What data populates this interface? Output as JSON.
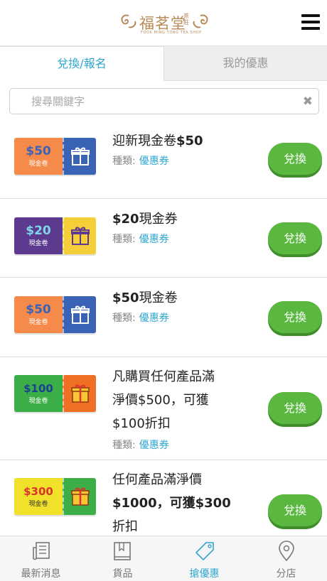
{
  "header": {
    "logo_text": "福茗堂",
    "logo_badge": "茶莊",
    "logo_subtitle": "FOOK MING TONG TEA SHOP"
  },
  "tabs": [
    {
      "label": "兌換/報名"
    },
    {
      "label": "我的優惠"
    }
  ],
  "search": {
    "placeholder": "搜尋關鍵字",
    "value": ""
  },
  "type_label": "種類:",
  "items": [
    {
      "coupon_amount": "$50",
      "coupon_tag": "現金卷",
      "coupon_color": "#f58a4a",
      "gift_color": "#3a63b5",
      "title_pre": "迎新現金卷",
      "title_bold": "$50",
      "title_post": "",
      "title2": "",
      "title3": "",
      "type_value": "優惠券",
      "button": "兌換"
    },
    {
      "coupon_amount": "$20",
      "coupon_tag": "現金卷",
      "coupon_color": "#5b3a8f",
      "gift_color": "#f5cf3a",
      "title_pre": "",
      "title_bold": "$20",
      "title_post": "現金券",
      "title2": "",
      "title3": "",
      "type_value": "優惠券",
      "button": "兌換"
    },
    {
      "coupon_amount": "$50",
      "coupon_tag": "現金卷",
      "coupon_color": "#f58a4a",
      "gift_color": "#3a63b5",
      "title_pre": "",
      "title_bold": "$50",
      "title_post": "現金卷",
      "title2": "",
      "title3": "",
      "type_value": "優惠券",
      "button": "兌換"
    },
    {
      "coupon_amount": "$100",
      "coupon_tag": "現金卷",
      "coupon_color": "#3cae48",
      "gift_color": "#ef6f24",
      "title_pre": "凡購買任何產品滿",
      "title_bold": "",
      "title_post": "",
      "title2": "淨價$500，可獲",
      "title3": "$100折扣",
      "type_value": "優惠券",
      "button": "兌換"
    },
    {
      "coupon_amount": "$300",
      "coupon_tag": "現金卷",
      "coupon_color": "#f2e12a",
      "gift_color": "#3cae48",
      "title_pre": "任何產品滿淨價",
      "title_bold": "",
      "title_post": "",
      "title2": "$1000，可獲$300",
      "title3": "折扣",
      "type_value": "",
      "button": "兌換"
    }
  ],
  "tabbar": [
    {
      "label": "最新消息",
      "icon": "news-icon"
    },
    {
      "label": "貨品",
      "icon": "book-icon"
    },
    {
      "label": "搶優惠",
      "icon": "tag-icon"
    },
    {
      "label": "分店",
      "icon": "location-pin-icon"
    }
  ],
  "colors": {
    "accent": "#2fa6d0",
    "button": "#5ab840"
  }
}
